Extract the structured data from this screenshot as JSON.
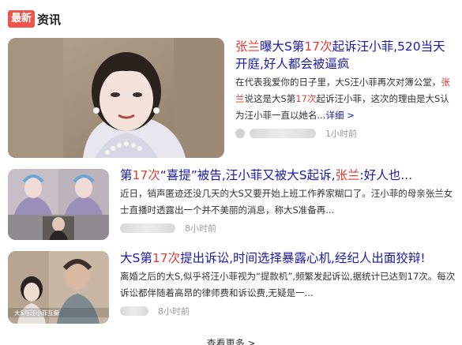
{
  "header": {
    "badge": "最新",
    "label": "资讯"
  },
  "news": [
    {
      "title_parts": [
        "张兰",
        "曝大S第",
        "17次",
        "起诉汪小菲,520当天开庭,好人都会被逼疯"
      ],
      "summary_parts": [
        "在代表我爱你的日子里，大S汪小菲再次对簿公堂，",
        "张兰",
        "说这是大S第",
        "17次",
        "起诉汪小菲，这次的理由是大S认为汪小菲一直以她名...",
        "详细 >"
      ],
      "time": "1小时前"
    },
    {
      "title_parts": [
        "第",
        "17次",
        "“喜提”被告,汪小菲又被大S起诉,",
        "张兰",
        ":好人也..."
      ],
      "summary": "近日，销声匿迹还没几天的大S又要开始上班工作养家糊口了。汪小菲的母亲张兰女士直播时透露出一个并不美丽的消息，称大S准备再...",
      "time": "8小时前"
    },
    {
      "title_parts": [
        "大S第",
        "17次",
        "提出诉讼,时间选择暴露心机,经纪人出面狡辩!"
      ],
      "summary": "离婚之后的大S,似乎将汪小菲视为“提款机”,频繁发起诉讼,据统计已达到17次。每次诉讼都伴随着高昂的律师费和诉讼费,无疑是一...",
      "time": "8小时前",
      "thumb_caption": "大S与汪小菲互撕"
    }
  ],
  "load_more": "查看更多 >",
  "colors": {
    "accent": "#f0544d",
    "title": "#1a1aa8",
    "highlight": "#e33b35"
  }
}
